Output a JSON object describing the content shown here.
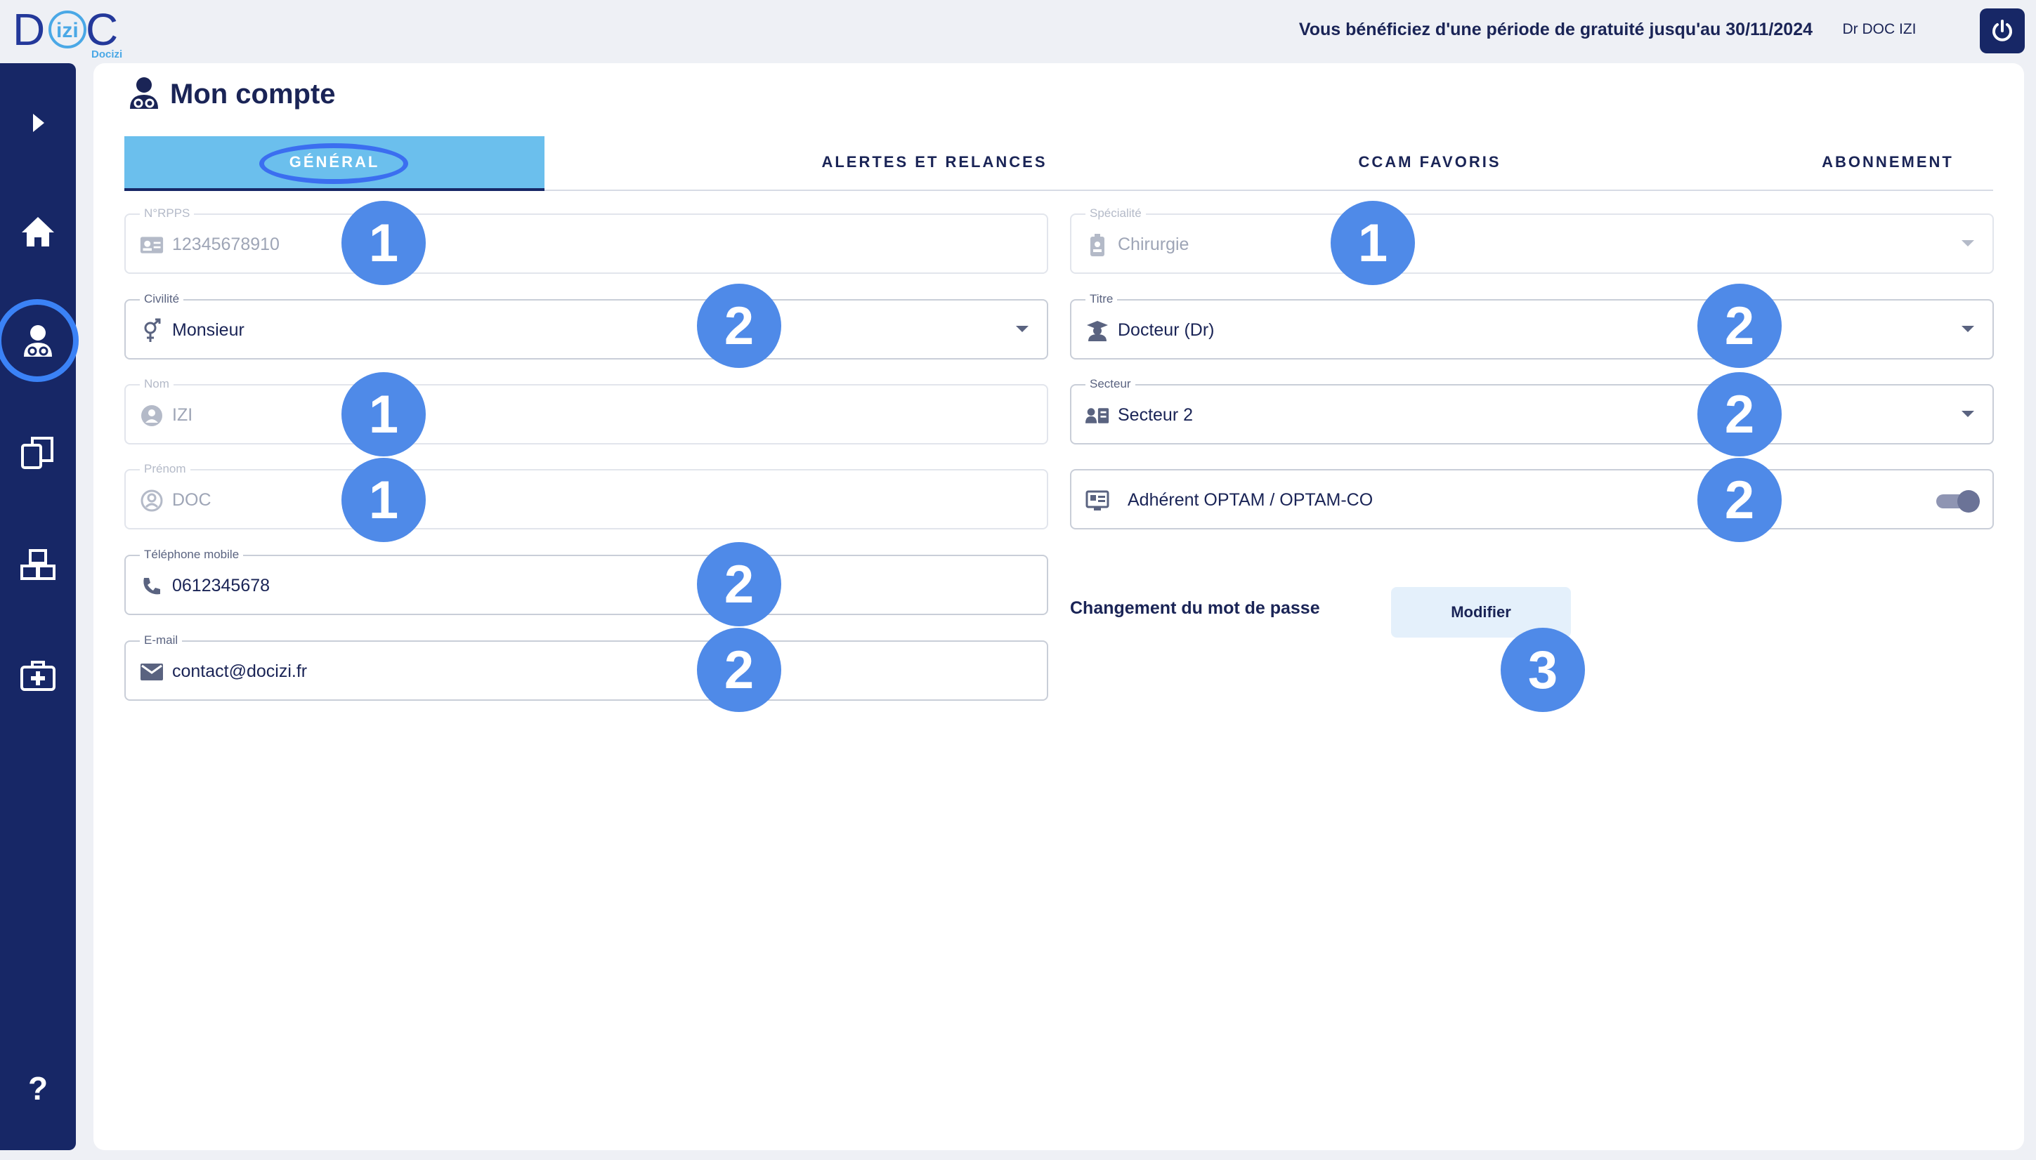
{
  "header": {
    "logo_text": "DOC",
    "logo_inner": "izi",
    "logo_sub": "Docizi",
    "promo": "Vous bénéficiez d'une période de gratuité jusqu'au 30/11/2024",
    "user": "Dr DOC IZI",
    "power_icon": "power-icon"
  },
  "sidebar": {
    "items": [
      {
        "name": "expand",
        "icon": "chevron-right-icon"
      },
      {
        "name": "home",
        "icon": "home-icon"
      },
      {
        "name": "account",
        "icon": "doctor-icon",
        "active": true
      },
      {
        "name": "documents",
        "icon": "documents-icon"
      },
      {
        "name": "products",
        "icon": "boxes-icon"
      },
      {
        "name": "medical",
        "icon": "medical-kit-icon"
      },
      {
        "name": "help",
        "icon": "help-icon",
        "label": "?"
      }
    ]
  },
  "page": {
    "title": "Mon compte"
  },
  "tabs": [
    {
      "label": "GÉNÉRAL",
      "active": true
    },
    {
      "label": "ALERTES ET RELANCES"
    },
    {
      "label": "CCAM FAVORIS"
    },
    {
      "label": "ABONNEMENT"
    }
  ],
  "fields": {
    "rpps": {
      "label": "N°RPPS",
      "value": "12345678910",
      "disabled": true
    },
    "civilite": {
      "label": "Civilité",
      "value": "Monsieur"
    },
    "nom": {
      "label": "Nom",
      "value": "IZI",
      "disabled": true
    },
    "prenom": {
      "label": "Prénom",
      "value": "DOC",
      "disabled": true
    },
    "telephone": {
      "label": "Téléphone mobile",
      "value": "0612345678"
    },
    "email": {
      "label": "E-mail",
      "value": "contact@docizi.fr"
    },
    "specialite": {
      "label": "Spécialité",
      "value": "Chirurgie",
      "disabled": true
    },
    "titre": {
      "label": "Titre",
      "value": "Docteur (Dr)"
    },
    "secteur": {
      "label": "Secteur",
      "value": "Secteur 2"
    },
    "optam": {
      "label": "Adhérent OPTAM / OPTAM-CO",
      "enabled": true
    }
  },
  "password": {
    "label": "Changement du mot de passe",
    "button": "Modifier"
  },
  "markers": [
    "1",
    "2",
    "1",
    "1",
    "2",
    "2",
    "1",
    "2",
    "2",
    "2",
    "3"
  ],
  "colors": {
    "navy": "#172766",
    "tab_active": "#6bbfed",
    "marker": "#4f8ae8",
    "ring": "#3b6ef0"
  }
}
